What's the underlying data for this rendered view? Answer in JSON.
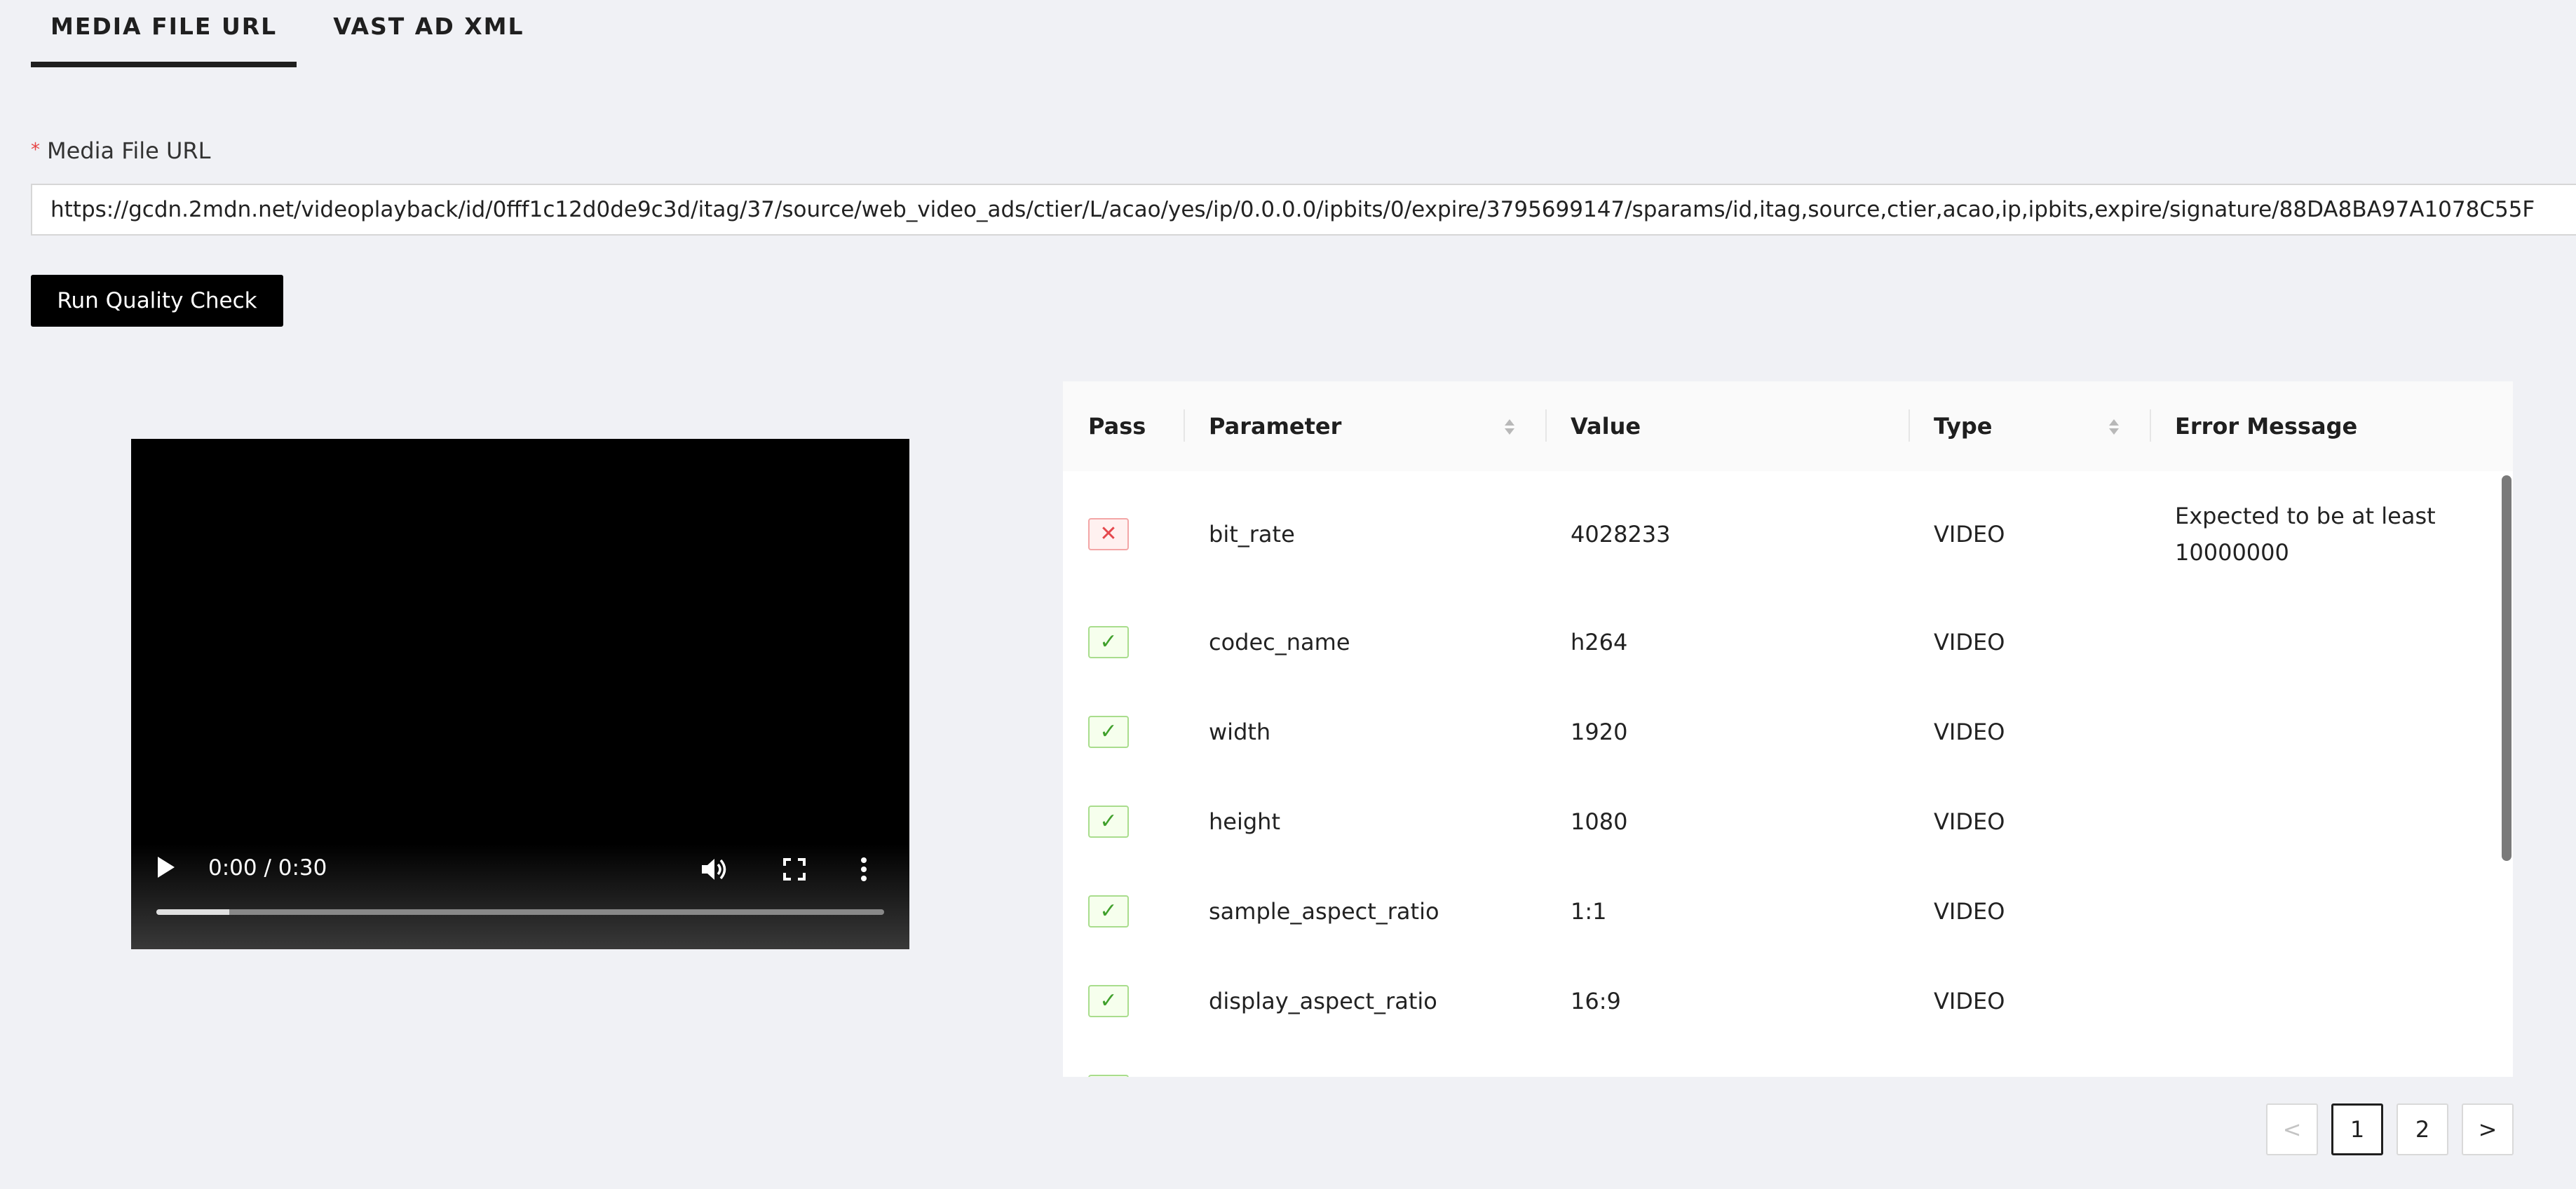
{
  "tabs": [
    {
      "label": "MEDIA FILE URL",
      "active": true
    },
    {
      "label": "VAST AD XML",
      "active": false
    }
  ],
  "form": {
    "required_mark": "*",
    "url_label": "Media File URL",
    "url_value": "https://gcdn.2mdn.net/videoplayback/id/0fff1c12d0de9c3d/itag/37/source/web_video_ads/ctier/L/acao/yes/ip/0.0.0.0/ipbits/0/expire/3795699147/sparams/id,itag,source,ctier,acao,ip,ipbits,expire/signature/88DA8BA97A1078C55F",
    "run_button": "Run Quality Check"
  },
  "video": {
    "time": "0:00 / 0:30",
    "progress": 0.1,
    "icons": [
      "play-icon",
      "volume-icon",
      "fullscreen-icon",
      "more-icon"
    ]
  },
  "table": {
    "columns": [
      "Pass",
      "Parameter",
      "Value",
      "Type",
      "Error Message"
    ],
    "rows": [
      {
        "pass": false,
        "parameter": "bit_rate",
        "value": "4028233",
        "type": "VIDEO",
        "error": "Expected to be at least 10000000"
      },
      {
        "pass": true,
        "parameter": "codec_name",
        "value": "h264",
        "type": "VIDEO",
        "error": ""
      },
      {
        "pass": true,
        "parameter": "width",
        "value": "1920",
        "type": "VIDEO",
        "error": ""
      },
      {
        "pass": true,
        "parameter": "height",
        "value": "1080",
        "type": "VIDEO",
        "error": ""
      },
      {
        "pass": true,
        "parameter": "sample_aspect_ratio",
        "value": "1:1",
        "type": "VIDEO",
        "error": ""
      },
      {
        "pass": true,
        "parameter": "display_aspect_ratio",
        "value": "16:9",
        "type": "VIDEO",
        "error": ""
      },
      {
        "pass": true,
        "parameter": "",
        "value": "",
        "type": "",
        "error": ""
      }
    ],
    "pass_symbol": "✓",
    "fail_symbol": "✕"
  },
  "pagination": {
    "prev": "<",
    "pages": [
      "1",
      "2"
    ],
    "current": "1",
    "next": ">"
  }
}
